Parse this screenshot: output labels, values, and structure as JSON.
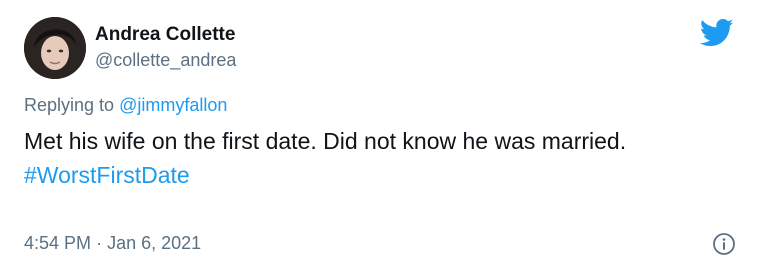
{
  "tweet": {
    "display_name": "Andrea Collette",
    "handle": "@collette_andrea",
    "reply_prefix": "Replying to",
    "reply_to": "@jimmyfallon",
    "text": "Met his wife on the first date. Did not know he was married.",
    "hashtag": "#WorstFirstDate",
    "time": "4:54 PM",
    "separator": "·",
    "date": "Jan 6, 2021"
  },
  "icons": {
    "brand": "twitter-bird-icon",
    "info": "info-icon"
  },
  "colors": {
    "link": "#1d9bf0",
    "secondary_text": "#5b7083",
    "primary_text": "#0f1419"
  }
}
